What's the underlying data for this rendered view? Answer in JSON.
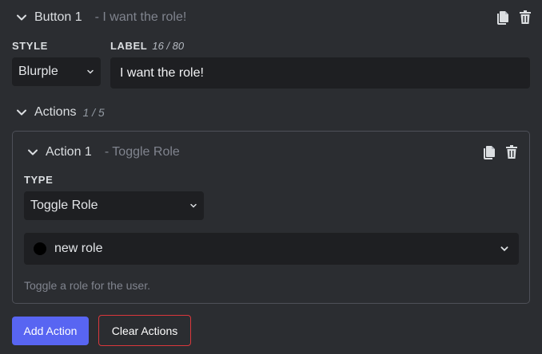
{
  "button": {
    "title": "Button 1",
    "subtitle": "- I want the role!",
    "style_label": "STYLE",
    "style_value": "Blurple",
    "label_label": "LABEL",
    "label_count": "16 / 80",
    "label_value": "I want the role!"
  },
  "actions": {
    "title": "Actions",
    "count": "1 / 5",
    "items": [
      {
        "title": "Action 1",
        "subtitle": "- Toggle Role",
        "type_label": "TYPE",
        "type_value": "Toggle Role",
        "role_value": "new role",
        "help": "Toggle a role for the user."
      }
    ]
  },
  "footer": {
    "add_label": "Add Action",
    "clear_label": "Clear Actions"
  },
  "colors": {
    "background": "#2b2d31",
    "input_bg": "#1e1f22",
    "primary": "#5865f2",
    "danger": "#da373c",
    "role_color": "#000000"
  }
}
